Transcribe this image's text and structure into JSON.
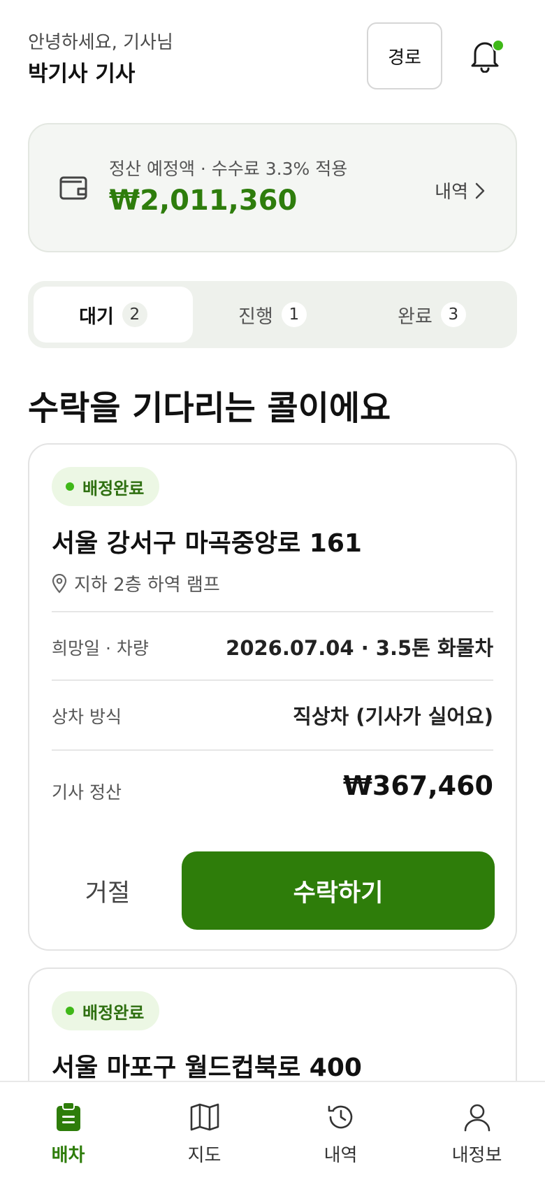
{
  "header": {
    "greeting": "안녕하세요, 기사님",
    "driver_name": "박기사 기사",
    "route_button": "경로"
  },
  "settlement": {
    "label": "정산 예정액 · 수수료 3.3% 적용",
    "amount": "₩2,011,360",
    "link_label": "내역"
  },
  "tabs": [
    {
      "label": "대기",
      "count": "2",
      "active": true
    },
    {
      "label": "진행",
      "count": "1",
      "active": false
    },
    {
      "label": "완료",
      "count": "3",
      "active": false
    }
  ],
  "section_title": "수락을 기다리는 콜이에요",
  "jobs": [
    {
      "status": "배정완료",
      "address": "서울 강서구 마곡중앙로 161",
      "note": "지하 2층 하역 램프",
      "rows": [
        {
          "label": "희망일 · 차량",
          "value": "2026.07.04 · 3.5톤 화물차"
        },
        {
          "label": "상차 방식",
          "value": "직상차 (기사가 실어요)"
        },
        {
          "label": "기사 정산",
          "value": "₩367,460"
        }
      ],
      "reject_label": "거절",
      "accept_label": "수락하기"
    },
    {
      "status": "배정완료",
      "address": "서울 마포구 월드컵북로 400"
    }
  ],
  "bottom_nav": [
    {
      "label": "배차",
      "icon": "clipboard-icon",
      "active": true
    },
    {
      "label": "지도",
      "icon": "map-icon",
      "active": false
    },
    {
      "label": "내역",
      "icon": "history-icon",
      "active": false
    },
    {
      "label": "내정보",
      "icon": "person-icon",
      "active": false
    }
  ],
  "colors": {
    "accent": "#2e7d0a",
    "notification_dot": "#3fb818",
    "badge_bg": "#ecf7e4"
  }
}
